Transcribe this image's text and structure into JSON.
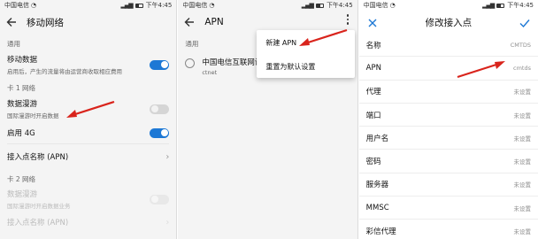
{
  "panel1": {
    "status": {
      "carrier": "中国电信",
      "time": "下午4:45"
    },
    "title": "移动网络",
    "sections": {
      "general": "通用",
      "sim1": "卡 1 网络",
      "sim2": "卡 2 网络"
    },
    "mobile_data": {
      "label": "移动数据",
      "desc": "启用后，产生的流量将由运营商收取相应费用",
      "enabled": true
    },
    "roaming1": {
      "label": "数据漫游",
      "desc": "国际漫游时开启数据",
      "enabled": false
    },
    "enable4g": {
      "label": "启用 4G",
      "enabled": true
    },
    "apn1": {
      "label": "接入点名称 (APN)"
    },
    "roaming2": {
      "label": "数据漫游",
      "desc": "国际漫游时开启数据业务",
      "enabled": false
    },
    "apn2": {
      "label": "接入点名称 (APN)"
    }
  },
  "panel2": {
    "status": {
      "carrier": "中国电信",
      "time": "下午4:45"
    },
    "title": "APN",
    "section": "通用",
    "apn_item": {
      "name": "中国电信互联网设",
      "sub": "ctnet"
    },
    "menu": {
      "new_apn": "新建 APN",
      "reset": "重置为默认设置"
    }
  },
  "panel3": {
    "status": {
      "carrier": "中国电信",
      "time": "下午4:45"
    },
    "title": "修改接入点",
    "fields": [
      {
        "label": "名称",
        "value": "CMTDS"
      },
      {
        "label": "APN",
        "value": "cmtds"
      },
      {
        "label": "代理",
        "value": "未设置"
      },
      {
        "label": "端口",
        "value": "未设置"
      },
      {
        "label": "用户名",
        "value": "未设置"
      },
      {
        "label": "密码",
        "value": "未设置"
      },
      {
        "label": "服务器",
        "value": "未设置"
      },
      {
        "label": "MMSC",
        "value": "未设置"
      },
      {
        "label": "彩信代理",
        "value": "未设置"
      }
    ]
  },
  "colors": {
    "accent": "#1d78d5",
    "arrow": "#d9241c"
  }
}
